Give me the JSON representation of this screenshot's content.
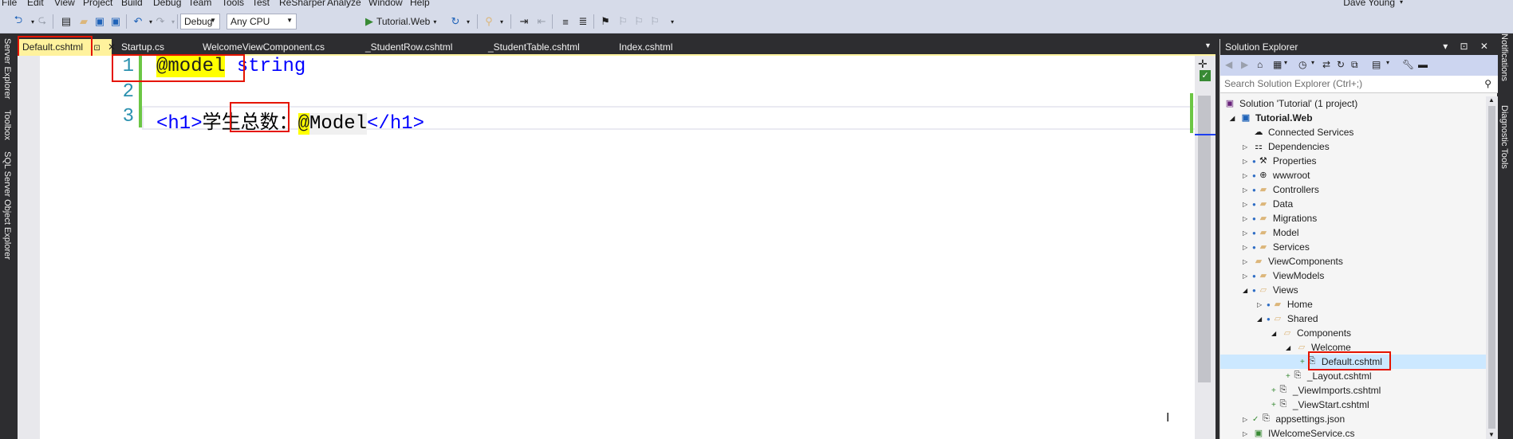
{
  "menu": [
    "File",
    "Edit",
    "View",
    "Project",
    "Build",
    "Debug",
    "Team",
    "Tools",
    "Test",
    "ReSharper",
    "Analyze",
    "Window",
    "Help"
  ],
  "user": "Dave Young",
  "toolbar": {
    "config": "Debug",
    "platform": "Any CPU",
    "run_target": "Tutorial.Web"
  },
  "left_strip": [
    "Server Explorer",
    "Toolbox",
    "SQL Server Object Explorer"
  ],
  "right_strip": [
    "Notifications",
    "Diagnostic Tools"
  ],
  "tabs": [
    "Default.cshtml",
    "Startup.cs",
    "WelcomeViewComponent.cs",
    "_StudentRow.cshtml",
    "_StudentTable.cshtml",
    "Index.cshtml"
  ],
  "editor": {
    "line_numbers": [
      "1",
      "2",
      "3"
    ],
    "line1": {
      "directive": "@model",
      "type": "string"
    },
    "line3": {
      "open_tag": "<h1>",
      "text": "学生总数：",
      "at": "@",
      "model": "Model",
      "close_tag": "</h1>"
    }
  },
  "solution_explorer": {
    "title": "Solution Explorer",
    "search_placeholder": "Search Solution Explorer (Ctrl+;)",
    "tree": [
      "Solution 'Tutorial' (1 project)",
      "Tutorial.Web",
      "Connected Services",
      "Dependencies",
      "Properties",
      "wwwroot",
      "Controllers",
      "Data",
      "Migrations",
      "Model",
      "Services",
      "ViewComponents",
      "ViewModels",
      "Views",
      "Home",
      "Shared",
      "Components",
      "Welcome",
      "Default.cshtml",
      "_Layout.cshtml",
      "_ViewImports.cshtml",
      "_ViewStart.cshtml",
      "appsettings.json",
      "IWelcomeService.cs"
    ]
  },
  "colors": {
    "active_tab": "#fff29d",
    "highlight_box": "#e51400",
    "razor_highlight": "#ffff00",
    "keyword": "#0000ff",
    "line_number": "#2b91af",
    "ide_dark": "#2d2d30"
  }
}
